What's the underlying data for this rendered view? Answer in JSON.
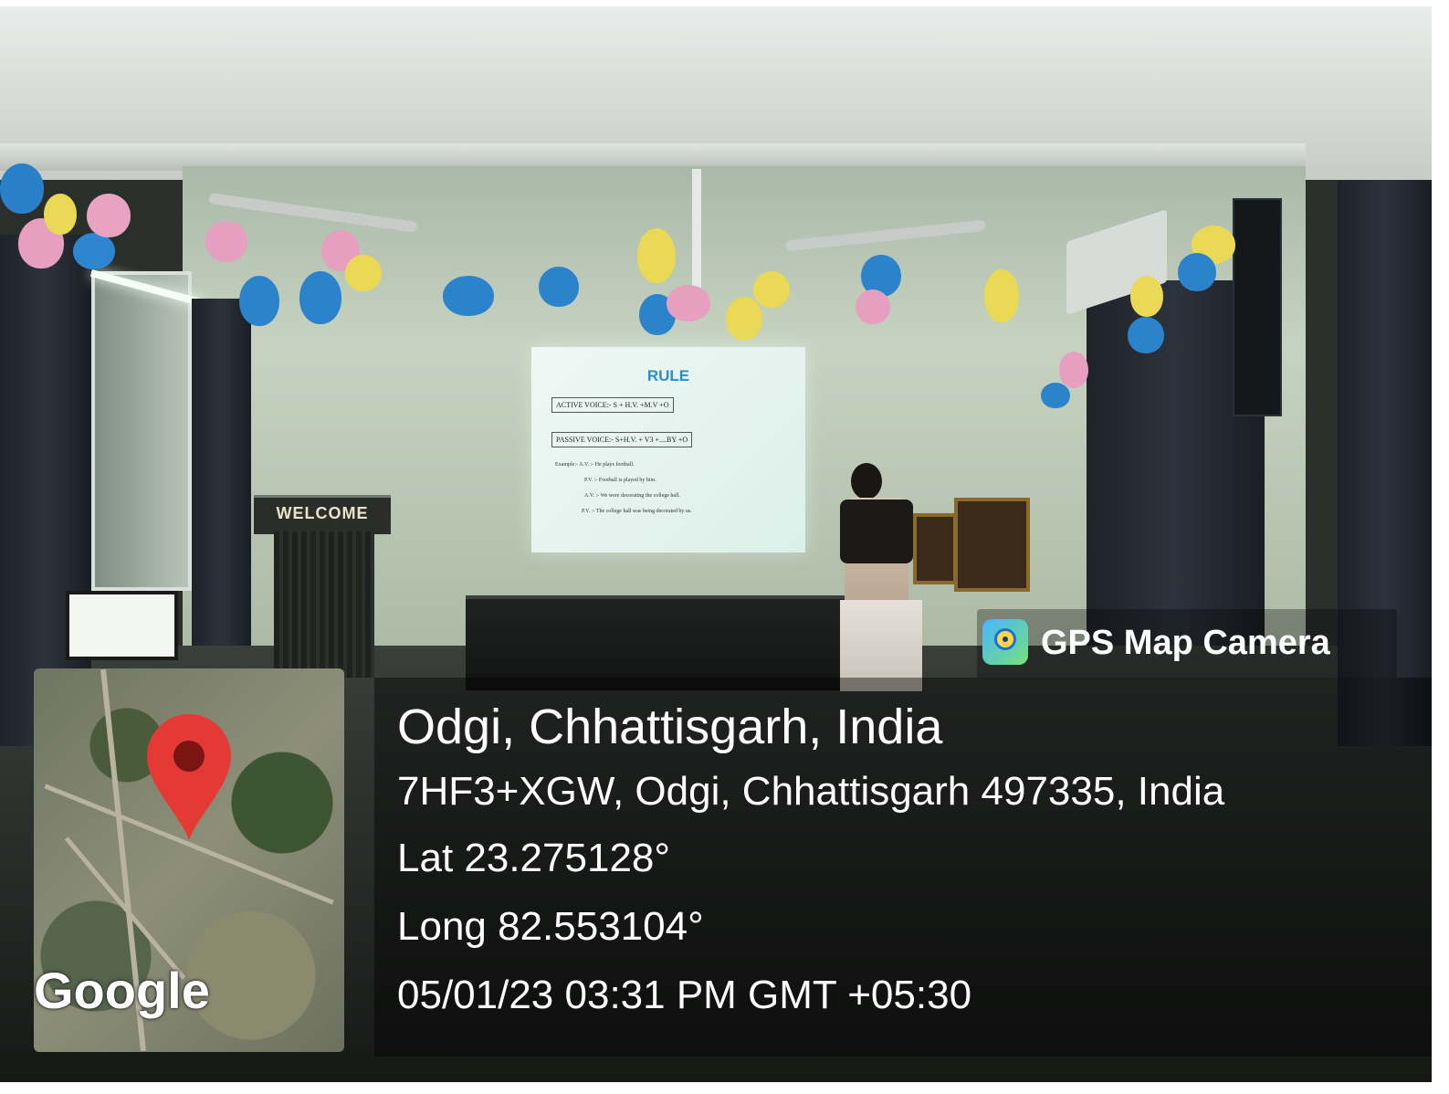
{
  "screen_slide": {
    "title": "RULE",
    "active_voice": "ACTIVE VOICE:-   S + H.V. +M.V +O",
    "passive_voice": "PASSIVE VOICE:-   S+H.V. + V3 +....BY +O",
    "example_av1": "Example:- A.V. :-    He plays football.",
    "example_pv1": "P.V. :-    Football is played by him.",
    "example_av2": "A.V. :-    We were decorating the college hall.",
    "example_pv2": "P.V. :-   The college hall was being decorated by us."
  },
  "podium": {
    "label": "WELCOME"
  },
  "watermark": {
    "app_name": "GPS Map Camera",
    "icon": "gps-camera-app-icon",
    "location": "Odgi, Chhattisgarh, India",
    "address": "7HF3+XGW, Odgi, Chhattisgarh 497335, India",
    "latitude": "Lat 23.275128°",
    "longitude": "Long 82.553104°",
    "datetime": "05/01/23 03:31 PM GMT +05:30"
  },
  "map": {
    "provider": "Google",
    "pin_icon": "location-pin-icon",
    "pin_color": "#e53935"
  }
}
